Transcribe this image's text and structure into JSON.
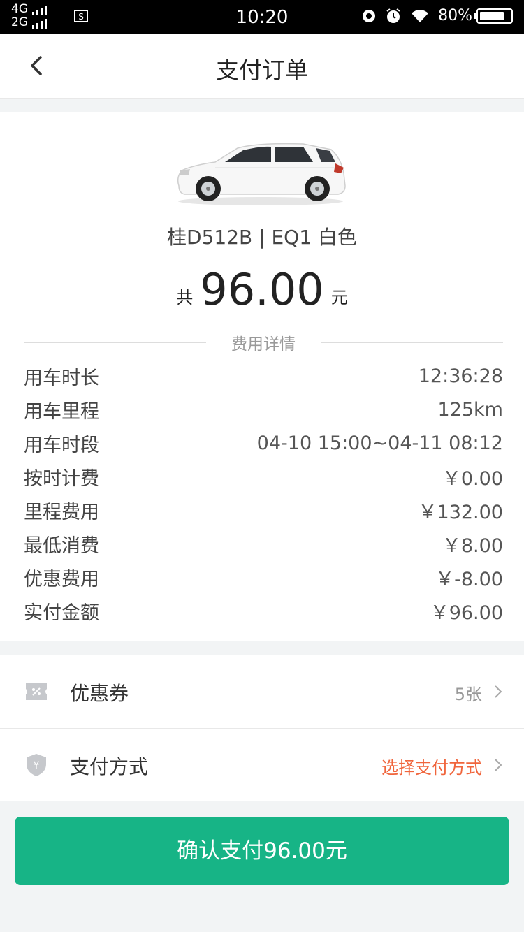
{
  "status_bar": {
    "network_top": "4G",
    "network_bottom": "2G",
    "time": "10:20",
    "battery": "80%",
    "battery_level": 0.8
  },
  "nav": {
    "back_icon": "chevron-left-icon",
    "title": "支付订单"
  },
  "car": {
    "image_icon": "white-hatchback-car",
    "info": "桂D512B | EQ1 白色"
  },
  "total": {
    "prefix": "共",
    "amount": "96.00",
    "suffix": "元"
  },
  "details": {
    "title": "费用详情",
    "rows": [
      {
        "label": "用车时长",
        "value": "12:36:28"
      },
      {
        "label": "用车里程",
        "value": "125km"
      },
      {
        "label": "用车时段",
        "value": "04-10 15:00~04-11 08:12"
      },
      {
        "label": "按时计费",
        "value": "￥0.00"
      },
      {
        "label": "里程费用",
        "value": "￥132.00"
      },
      {
        "label": "最低消费",
        "value": "￥8.00"
      },
      {
        "label": "优惠费用",
        "value": "￥-8.00"
      },
      {
        "label": "实付金额",
        "value": "￥96.00"
      }
    ]
  },
  "coupon": {
    "icon": "coupon-icon",
    "label": "优惠券",
    "value": "5张"
  },
  "payment": {
    "icon": "shield-yen-icon",
    "label": "支付方式",
    "value": "选择支付方式"
  },
  "pay_button": {
    "label": "确认支付96.00元"
  },
  "colors": {
    "accent": "#17b486",
    "highlight": "#f0653c",
    "background": "#f2f4f5"
  }
}
